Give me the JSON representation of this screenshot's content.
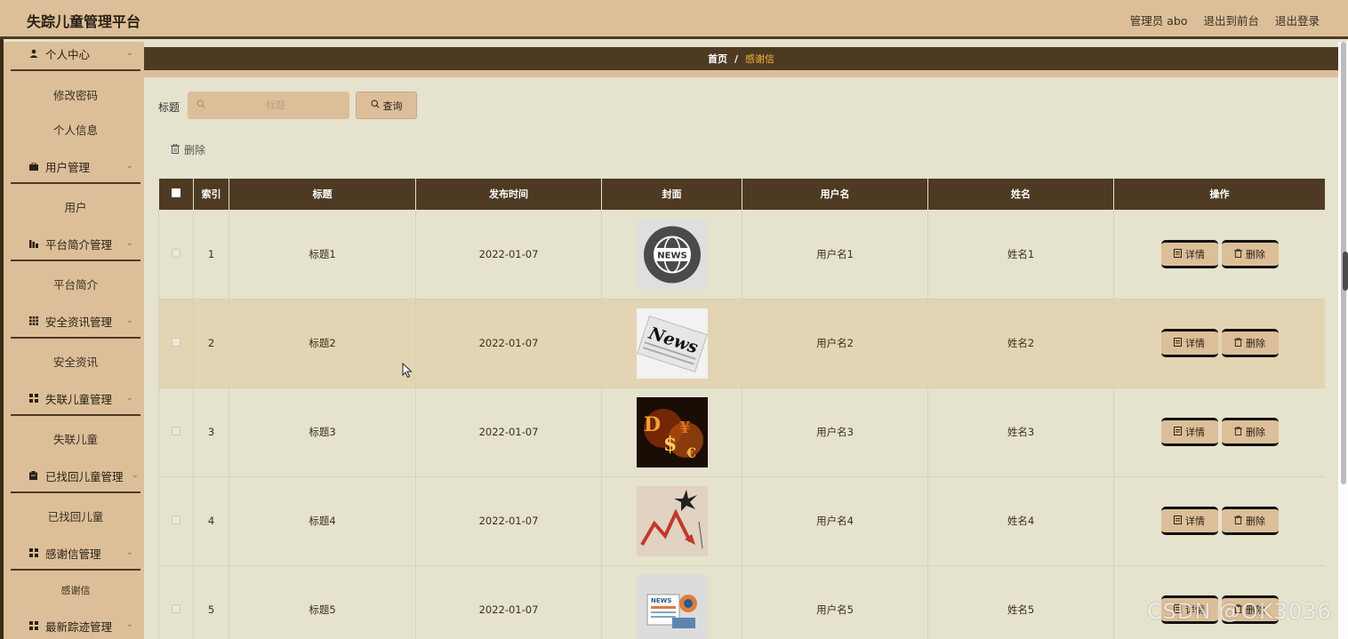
{
  "app": {
    "title": "失踪儿童管理平台"
  },
  "topbar": {
    "admin_label": "管理员 abo",
    "exit_front": "退出到前台",
    "logout": "退出登录"
  },
  "sidebar": {
    "groups": [
      {
        "label": "个人中心",
        "icon": "user-icon",
        "items": [
          "修改密码",
          "个人信息"
        ]
      },
      {
        "label": "用户管理",
        "icon": "briefcase-icon",
        "items": [
          "用户"
        ]
      },
      {
        "label": "平台简介管理",
        "icon": "bar-chart-icon",
        "items": [
          "平台简介"
        ]
      },
      {
        "label": "安全资讯管理",
        "icon": "grid-icon",
        "items": [
          "安全资讯"
        ]
      },
      {
        "label": "失联儿童管理",
        "icon": "apps-icon",
        "items": [
          "失联儿童"
        ]
      },
      {
        "label": "已找回儿童管理",
        "icon": "clipboard-icon",
        "items": [
          "已找回儿童"
        ]
      },
      {
        "label": "感谢信管理",
        "icon": "apps-icon",
        "items": [
          "感谢信"
        ]
      },
      {
        "label": "最新踪迹管理",
        "icon": "apps-icon",
        "items": []
      }
    ]
  },
  "breadcrumb": {
    "home": "首页",
    "separator": "/",
    "current": "感谢信"
  },
  "search": {
    "label": "标题",
    "placeholder": "标题",
    "value": "",
    "query_button": "查询"
  },
  "toolbar": {
    "delete_label": "删除"
  },
  "table": {
    "columns": [
      "索引",
      "标题",
      "发布时间",
      "封面",
      "用户名",
      "姓名",
      "操作"
    ],
    "rows": [
      {
        "index": "1",
        "title": "标题1",
        "date": "2022-01-07",
        "cover": "news-globe-image",
        "username": "用户名1",
        "name": "姓名1"
      },
      {
        "index": "2",
        "title": "标题2",
        "date": "2022-01-07",
        "cover": "news-paper-image",
        "username": "用户名2",
        "name": "姓名2"
      },
      {
        "index": "3",
        "title": "标题3",
        "date": "2022-01-07",
        "cover": "dollar-fire-image",
        "username": "用户名3",
        "name": "姓名3"
      },
      {
        "index": "4",
        "title": "标题4",
        "date": "2022-01-07",
        "cover": "falling-chart-image",
        "username": "用户名4",
        "name": "姓名4"
      },
      {
        "index": "5",
        "title": "标题5",
        "date": "2022-01-07",
        "cover": "news-illustration-image",
        "username": "用户名5",
        "name": "姓名5"
      }
    ],
    "row_actions": {
      "detail": "详情",
      "delete": "删除"
    }
  },
  "watermark": "CSDN @OK3036",
  "colors": {
    "header_bg": "#dcbf98",
    "accent_dark": "#4e3a22",
    "page_bg": "#e5e2cd",
    "stripe": "#e3d4b3",
    "breadcrumb_current": "#f2b33d"
  }
}
